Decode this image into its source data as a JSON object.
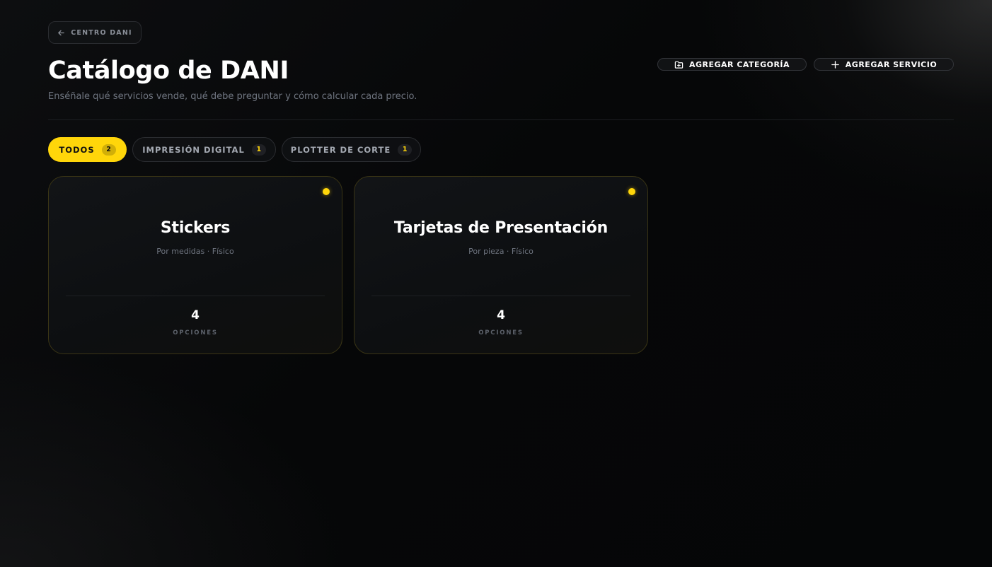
{
  "header": {
    "back_label": "CENTRO DANI",
    "title": "Catálogo de DANI",
    "subtitle": "Enséñale qué servicios vende, qué debe preguntar y cómo calcular cada precio.",
    "add_category_label": "AGREGAR CATEGORÍA",
    "add_service_label": "AGREGAR SERVICIO"
  },
  "tabs": [
    {
      "label": "TODOS",
      "count": "2",
      "active": true
    },
    {
      "label": "IMPRESIÓN DIGITAL",
      "count": "1",
      "active": false
    },
    {
      "label": "PLOTTER DE CORTE",
      "count": "1",
      "active": false
    }
  ],
  "services": [
    {
      "name": "Stickers",
      "meta": "Por medidas · Físico",
      "options_count": "4",
      "options_label": "OPCIONES",
      "status_color": "#ffd60a"
    },
    {
      "name": "Tarjetas de Presentación",
      "meta": "Por pieza · Físico",
      "options_count": "4",
      "options_label": "OPCIONES",
      "status_color": "#ffd60a"
    }
  ],
  "theme": {
    "accent": "#ffd60a",
    "background": "#050607",
    "muted_text": "#6f7580"
  },
  "icons": {
    "back": "arrow-left-icon",
    "add_category": "folder-plus-icon",
    "add_service": "plus-icon"
  }
}
